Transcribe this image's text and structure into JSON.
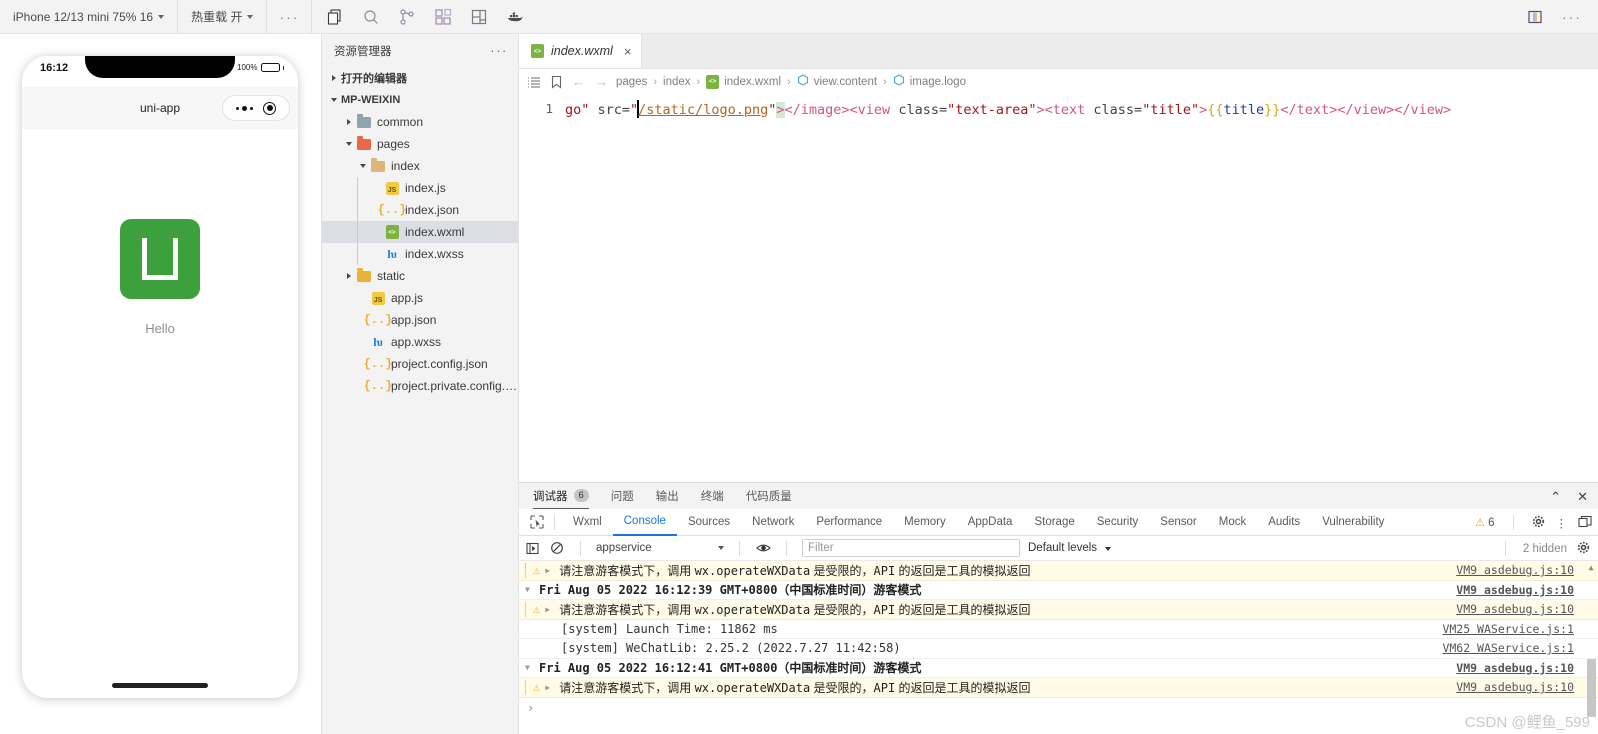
{
  "topbar": {
    "device_selector": "iPhone 12/13 mini 75% 16",
    "hot_reload": "热重载 开",
    "more_dots": "···",
    "icons": [
      {
        "name": "copy-files-icon"
      },
      {
        "name": "search-icon"
      },
      {
        "name": "source-control-icon"
      },
      {
        "name": "extensions-icon"
      },
      {
        "name": "split-layout-icon"
      },
      {
        "name": "docker-whale-icon"
      }
    ],
    "right_icons": [
      {
        "name": "toggle-panel-icon"
      },
      {
        "name": "more-actions-icon",
        "label": "···"
      }
    ]
  },
  "simulator": {
    "status_time": "16:12",
    "battery_percent": "100%",
    "nav_title": "uni-app",
    "logo_color": "#3ca13c",
    "hello_text": "Hello"
  },
  "explorer": {
    "title": "资源管理器",
    "more": "···",
    "open_editors": "打开的编辑器",
    "project_name": "MP-WEIXIN",
    "tree": [
      {
        "label": "common",
        "icon": "folder-icon",
        "indent": 1,
        "twisty": "closed",
        "selected": false
      },
      {
        "label": "pages",
        "icon": "folder-pages-icon",
        "indent": 1,
        "twisty": "open",
        "selected": false
      },
      {
        "label": "index",
        "icon": "folder-open-icon",
        "indent": 2,
        "twisty": "open",
        "selected": false
      },
      {
        "label": "index.js",
        "icon": "js-file-icon",
        "indent": 3,
        "twisty": "none",
        "selected": false
      },
      {
        "label": "index.json",
        "icon": "json-file-icon",
        "indent": 3,
        "twisty": "none",
        "selected": false
      },
      {
        "label": "index.wxml",
        "icon": "wxml-file-icon",
        "indent": 3,
        "twisty": "none",
        "selected": true
      },
      {
        "label": "index.wxss",
        "icon": "wxss-file-icon",
        "indent": 3,
        "twisty": "none",
        "selected": false
      },
      {
        "label": "static",
        "icon": "folder-static-icon",
        "indent": 1,
        "twisty": "closed",
        "selected": false
      },
      {
        "label": "app.js",
        "icon": "js-file-icon",
        "indent": 2,
        "twisty": "none",
        "selected": false
      },
      {
        "label": "app.json",
        "icon": "json-file-icon",
        "indent": 2,
        "twisty": "none",
        "selected": false
      },
      {
        "label": "app.wxss",
        "icon": "wxss-file-icon",
        "indent": 2,
        "twisty": "none",
        "selected": false
      },
      {
        "label": "project.config.json",
        "icon": "json-file-icon",
        "indent": 2,
        "twisty": "none",
        "selected": false
      },
      {
        "label": "project.private.config.js...",
        "icon": "json-file-icon",
        "indent": 2,
        "twisty": "none",
        "selected": false
      }
    ]
  },
  "editor": {
    "tab_label": "index.wxml",
    "tab_close": "×",
    "breadcrumb": [
      {
        "label": "pages",
        "icon": ""
      },
      {
        "label": "index",
        "icon": ""
      },
      {
        "label": "index.wxml",
        "icon": "wxml-file-icon"
      },
      {
        "label": "view.content",
        "icon": "symbol-icon"
      },
      {
        "label": "image.logo",
        "icon": "symbol-icon"
      }
    ],
    "breadcrumb_sep": "›",
    "line_number": "1",
    "code_tokens": [
      {
        "t": "go\"",
        "k": "str"
      },
      {
        "t": " src=",
        "k": "attr"
      },
      {
        "t": "\"",
        "k": "str"
      },
      {
        "t": "CURSOR",
        "k": "cursor"
      },
      {
        "t": "/static/logo.png",
        "k": "path"
      },
      {
        "t": "\"",
        "k": "str"
      },
      {
        "t": ">",
        "k": "sel"
      },
      {
        "t": "</image>",
        "k": "tag"
      },
      {
        "t": "<view ",
        "k": "tag"
      },
      {
        "t": "class=",
        "k": "attr"
      },
      {
        "t": "\"text-area\"",
        "k": "str"
      },
      {
        "t": ">",
        "k": "tag"
      },
      {
        "t": "<text ",
        "k": "tag"
      },
      {
        "t": "class=",
        "k": "attr"
      },
      {
        "t": "\"title\"",
        "k": "str"
      },
      {
        "t": ">",
        "k": "tag"
      },
      {
        "t": "{{",
        "k": "brace"
      },
      {
        "t": "title",
        "k": "mustache"
      },
      {
        "t": "}}",
        "k": "brace"
      },
      {
        "t": "</text>",
        "k": "tag"
      },
      {
        "t": "</view>",
        "k": "tag"
      },
      {
        "t": "</view>",
        "k": "tag"
      }
    ]
  },
  "panel": {
    "tabs": [
      {
        "label": "调试器",
        "badge": "6",
        "active": true
      },
      {
        "label": "问题",
        "badge": "",
        "active": false
      },
      {
        "label": "输出",
        "badge": "",
        "active": false
      },
      {
        "label": "终端",
        "badge": "",
        "active": false
      },
      {
        "label": "代码质量",
        "badge": "",
        "active": false
      }
    ],
    "collapse_icon": "⌃",
    "close_icon": "✕",
    "devtools_tabs": [
      {
        "label": "Wxml",
        "active": false
      },
      {
        "label": "Console",
        "active": true
      },
      {
        "label": "Sources",
        "active": false
      },
      {
        "label": "Network",
        "active": false
      },
      {
        "label": "Performance",
        "active": false
      },
      {
        "label": "Memory",
        "active": false
      },
      {
        "label": "AppData",
        "active": false
      },
      {
        "label": "Storage",
        "active": false
      },
      {
        "label": "Security",
        "active": false
      },
      {
        "label": "Sensor",
        "active": false
      },
      {
        "label": "Mock",
        "active": false
      },
      {
        "label": "Audits",
        "active": false
      },
      {
        "label": "Vulnerability",
        "active": false
      }
    ],
    "warning_count": "6",
    "settings_icon": "gear-icon",
    "kebab_icon": "more-vertical-icon",
    "dock_icon": "dock-panel-icon",
    "filter_bar": {
      "context": "appservice",
      "filter_placeholder": "Filter",
      "filter_value": "",
      "levels": "Default levels",
      "hidden_count": "2 hidden"
    },
    "console_rows": [
      {
        "type": "warn",
        "text_parts": [
          {
            "t": "请注意游客模式下，调用 ",
            "mono": false
          },
          {
            "t": "wx.operateWXData",
            "mono": true
          },
          {
            "t": " 是受限的，",
            "mono": false
          },
          {
            "t": "API",
            "mono": true
          },
          {
            "t": " 的返回是工具的模拟返回",
            "mono": false
          }
        ],
        "source": "VM9 asdebug.js:10",
        "source_bold": false
      },
      {
        "type": "group",
        "text_parts": [
          {
            "t": "Fri Aug 05 2022 16:12:39 GMT+0800（中国标准时间）游客模式",
            "mono": true
          }
        ],
        "source": "VM9 asdebug.js:10",
        "source_bold": true
      },
      {
        "type": "warn",
        "text_parts": [
          {
            "t": "请注意游客模式下，调用 ",
            "mono": false
          },
          {
            "t": "wx.operateWXData",
            "mono": true
          },
          {
            "t": " 是受限的，",
            "mono": false
          },
          {
            "t": "API",
            "mono": true
          },
          {
            "t": " 的返回是工具的模拟返回",
            "mono": false
          }
        ],
        "source": "VM9 asdebug.js:10",
        "source_bold": false
      },
      {
        "type": "system",
        "text_parts": [
          {
            "t": "[system] Launch Time: 11862 ms",
            "mono": true
          }
        ],
        "source": "VM25 WAService.js:1",
        "source_bold": false
      },
      {
        "type": "system",
        "text_parts": [
          {
            "t": "[system] WeChatLib: 2.25.2 (2022.7.27 11:42:58)",
            "mono": true
          }
        ],
        "source": "VM62 WAService.js:1",
        "source_bold": false
      },
      {
        "type": "group",
        "text_parts": [
          {
            "t": "Fri Aug 05 2022 16:12:41 GMT+0800（中国标准时间）游客模式",
            "mono": true
          }
        ],
        "source": "VM9 asdebug.js:10",
        "source_bold": true
      },
      {
        "type": "warn",
        "text_parts": [
          {
            "t": "请注意游客模式下，调用 ",
            "mono": false
          },
          {
            "t": "wx.operateWXData",
            "mono": true
          },
          {
            "t": " 是受限的，",
            "mono": false
          },
          {
            "t": "API",
            "mono": true
          },
          {
            "t": " 的返回是工具的模拟返回",
            "mono": false
          }
        ],
        "source": "VM9 asdebug.js:10",
        "source_bold": false
      }
    ],
    "prompt": "›"
  },
  "watermark": "CSDN @鲤鱼_599"
}
